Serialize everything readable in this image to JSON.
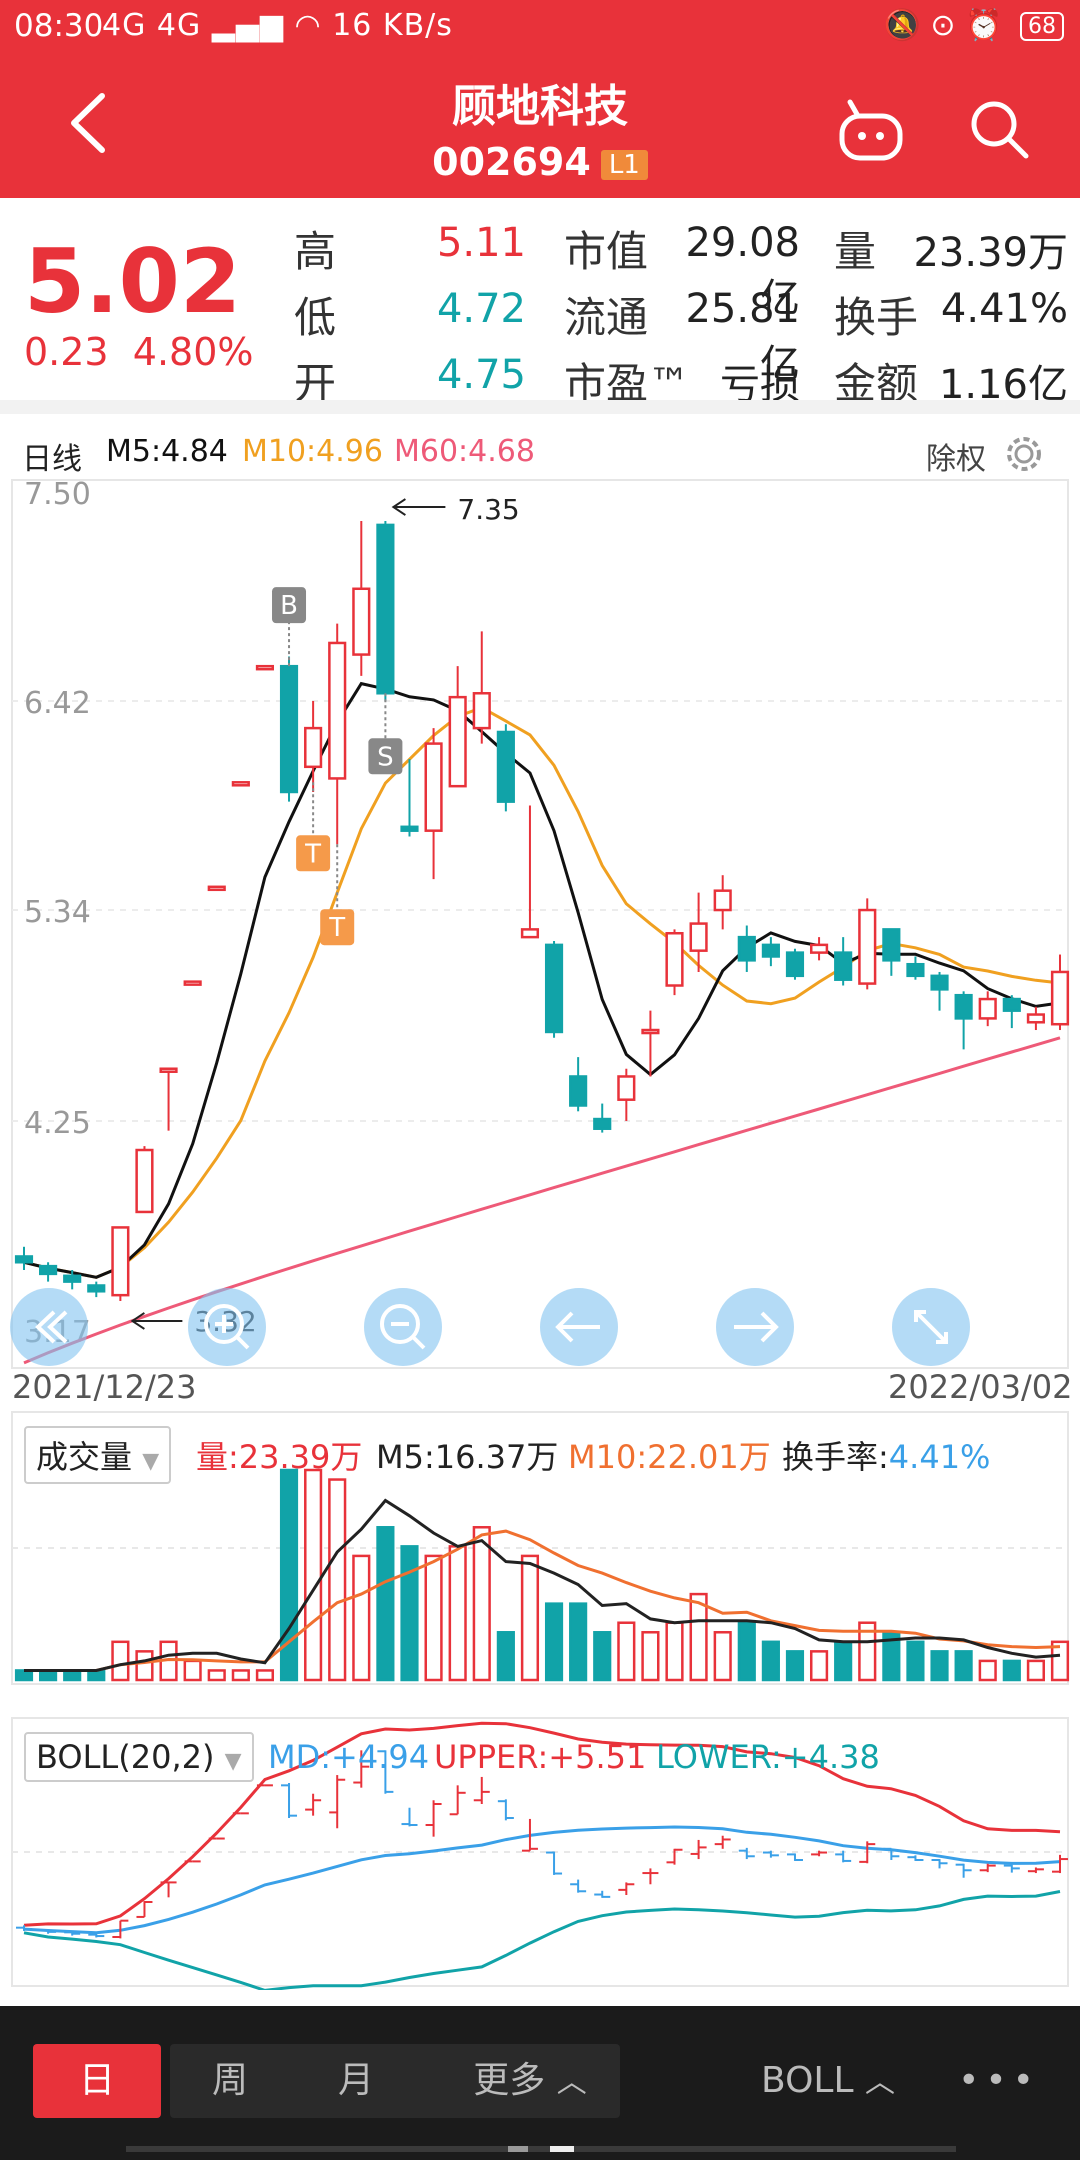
{
  "status": {
    "time": "08:30",
    "network": "4G 4G",
    "speed": "16 KB/s",
    "battery": "68"
  },
  "header": {
    "title": "顾地科技",
    "code": "002694",
    "badge": "L1"
  },
  "quote": {
    "price": "5.02",
    "change": "0.23",
    "change_pct": "4.80%",
    "rows": [
      {
        "l1": "高",
        "v1": "5.11",
        "l2": "市值",
        "v2": "29.08亿",
        "l3": "量",
        "v3": "23.39万"
      },
      {
        "l1": "低",
        "v1": "4.72",
        "l2": "流通",
        "v2": "25.81亿",
        "l3": "换手",
        "v3": "4.41%"
      },
      {
        "l1": "开",
        "v1": "4.75",
        "l2": "市盈™",
        "v2": "亏损",
        "l3": "金额",
        "v3": "1.16亿"
      }
    ]
  },
  "indicator": {
    "period": "日线",
    "m5": "M5:4.84",
    "m10": "M10:4.96",
    "m60": "M60:4.68",
    "exright": "除权"
  },
  "colors": {
    "up": "#e8323a",
    "down": "#11a3a8",
    "m5": "#111111",
    "m10": "#f0a020",
    "m60": "#ee5a78"
  },
  "chart_data": [
    {
      "type": "candlestick",
      "y_ticks": [
        "7.50",
        "6.42",
        "5.34",
        "4.25",
        "3.17"
      ],
      "ylim": [
        3.17,
        7.5
      ],
      "x_start": "2021/12/23",
      "x_end": "2022/03/02",
      "max_label": "7.35",
      "min_label": "3.32",
      "markers": [
        "B",
        "S",
        "T",
        "T"
      ],
      "candles": [
        {
          "o": 3.55,
          "c": 3.52,
          "h": 3.6,
          "l": 3.48,
          "up": false
        },
        {
          "o": 3.5,
          "c": 3.46,
          "h": 3.52,
          "l": 3.42,
          "up": false
        },
        {
          "o": 3.45,
          "c": 3.42,
          "h": 3.48,
          "l": 3.38,
          "up": false
        },
        {
          "o": 3.4,
          "c": 3.37,
          "h": 3.42,
          "l": 3.34,
          "up": false
        },
        {
          "o": 3.35,
          "c": 3.7,
          "h": 3.7,
          "l": 3.32,
          "up": true
        },
        {
          "o": 3.78,
          "c": 4.1,
          "h": 4.12,
          "l": 3.78,
          "up": true
        },
        {
          "o": 4.52,
          "c": 4.52,
          "h": 4.52,
          "l": 4.2,
          "up": true
        },
        {
          "o": 4.97,
          "c": 4.97,
          "h": 4.97,
          "l": 4.97,
          "up": true
        },
        {
          "o": 5.46,
          "c": 5.46,
          "h": 5.46,
          "l": 5.46,
          "up": true
        },
        {
          "o": 6.0,
          "c": 6.0,
          "h": 6.0,
          "l": 6.0,
          "up": true
        },
        {
          "o": 6.6,
          "c": 6.6,
          "h": 6.6,
          "l": 6.6,
          "up": true
        },
        {
          "o": 6.6,
          "c": 5.95,
          "h": 6.65,
          "l": 5.9,
          "up": false
        },
        {
          "o": 6.08,
          "c": 6.28,
          "h": 6.42,
          "l": 5.95,
          "up": true
        },
        {
          "o": 6.02,
          "c": 6.72,
          "h": 6.82,
          "l": 5.68,
          "up": true
        },
        {
          "o": 6.66,
          "c": 7.0,
          "h": 7.35,
          "l": 6.55,
          "up": true
        },
        {
          "o": 7.33,
          "c": 6.46,
          "h": 7.35,
          "l": 6.42,
          "up": false
        },
        {
          "o": 5.77,
          "c": 5.75,
          "h": 6.12,
          "l": 5.72,
          "up": false
        },
        {
          "o": 5.75,
          "c": 6.2,
          "h": 6.28,
          "l": 5.5,
          "up": true
        },
        {
          "o": 5.98,
          "c": 6.44,
          "h": 6.6,
          "l": 5.98,
          "up": true
        },
        {
          "o": 6.28,
          "c": 6.46,
          "h": 6.78,
          "l": 6.2,
          "up": true
        },
        {
          "o": 6.26,
          "c": 5.9,
          "h": 6.3,
          "l": 5.85,
          "up": false
        },
        {
          "o": 5.2,
          "c": 5.24,
          "h": 5.88,
          "l": 5.2,
          "up": true
        },
        {
          "o": 5.16,
          "c": 4.71,
          "h": 5.18,
          "l": 4.68,
          "up": false
        },
        {
          "o": 4.48,
          "c": 4.33,
          "h": 4.58,
          "l": 4.3,
          "up": false
        },
        {
          "o": 4.26,
          "c": 4.21,
          "h": 4.34,
          "l": 4.19,
          "up": false
        },
        {
          "o": 4.36,
          "c": 4.48,
          "h": 4.52,
          "l": 4.25,
          "up": true
        },
        {
          "o": 4.72,
          "c": 4.72,
          "h": 4.82,
          "l": 4.48,
          "up": true
        },
        {
          "o": 4.95,
          "c": 5.22,
          "h": 5.24,
          "l": 4.9,
          "up": true
        },
        {
          "o": 5.13,
          "c": 5.27,
          "h": 5.43,
          "l": 5.02,
          "up": true
        },
        {
          "o": 5.34,
          "c": 5.44,
          "h": 5.52,
          "l": 5.24,
          "up": true
        },
        {
          "o": 5.2,
          "c": 5.08,
          "h": 5.26,
          "l": 5.02,
          "up": false
        },
        {
          "o": 5.16,
          "c": 5.1,
          "h": 5.2,
          "l": 5.05,
          "up": false
        },
        {
          "o": 5.12,
          "c": 5.0,
          "h": 5.14,
          "l": 4.98,
          "up": false
        },
        {
          "o": 5.12,
          "c": 5.16,
          "h": 5.2,
          "l": 5.08,
          "up": true
        },
        {
          "o": 5.12,
          "c": 4.98,
          "h": 5.2,
          "l": 4.95,
          "up": false
        },
        {
          "o": 4.96,
          "c": 5.34,
          "h": 5.4,
          "l": 4.93,
          "up": true
        },
        {
          "o": 5.24,
          "c": 5.08,
          "h": 5.24,
          "l": 5.0,
          "up": false
        },
        {
          "o": 5.06,
          "c": 5.0,
          "h": 5.1,
          "l": 4.98,
          "up": false
        },
        {
          "o": 5.0,
          "c": 4.93,
          "h": 5.02,
          "l": 4.82,
          "up": false
        },
        {
          "o": 4.9,
          "c": 4.78,
          "h": 4.92,
          "l": 4.62,
          "up": false
        },
        {
          "o": 4.78,
          "c": 4.88,
          "h": 4.92,
          "l": 4.74,
          "up": true
        },
        {
          "o": 4.88,
          "c": 4.82,
          "h": 4.9,
          "l": 4.73,
          "up": false
        },
        {
          "o": 4.76,
          "c": 4.8,
          "h": 4.84,
          "l": 4.72,
          "up": true
        },
        {
          "o": 4.75,
          "c": 5.02,
          "h": 5.11,
          "l": 4.72,
          "up": true
        }
      ]
    },
    {
      "type": "bar",
      "selector": "成交量",
      "vol": "量:23.39万",
      "m5": "M5:16.37万",
      "m10": "M10:22.01万",
      "turnover_label": "换手率:",
      "turnover": "4.41%",
      "values": [
        1,
        1,
        1,
        1,
        4,
        3,
        4,
        2,
        1,
        1,
        1,
        22,
        22,
        21,
        13,
        16,
        14,
        13,
        14,
        16,
        5,
        13,
        8,
        8,
        5,
        6,
        5,
        6,
        9,
        5,
        6,
        4,
        3,
        3,
        4,
        6,
        5,
        4,
        3,
        3,
        2,
        2,
        2,
        4
      ]
    },
    {
      "type": "line",
      "selector": "BOLL(20,2)",
      "md": "MD:+4.94",
      "upper": "UPPER:+5.51",
      "lower": "LOWER:+4.38"
    }
  ],
  "bottom": {
    "day": "日",
    "week": "周",
    "month": "月",
    "more": "更多",
    "boll": "BOLL",
    "menu": "•••"
  }
}
